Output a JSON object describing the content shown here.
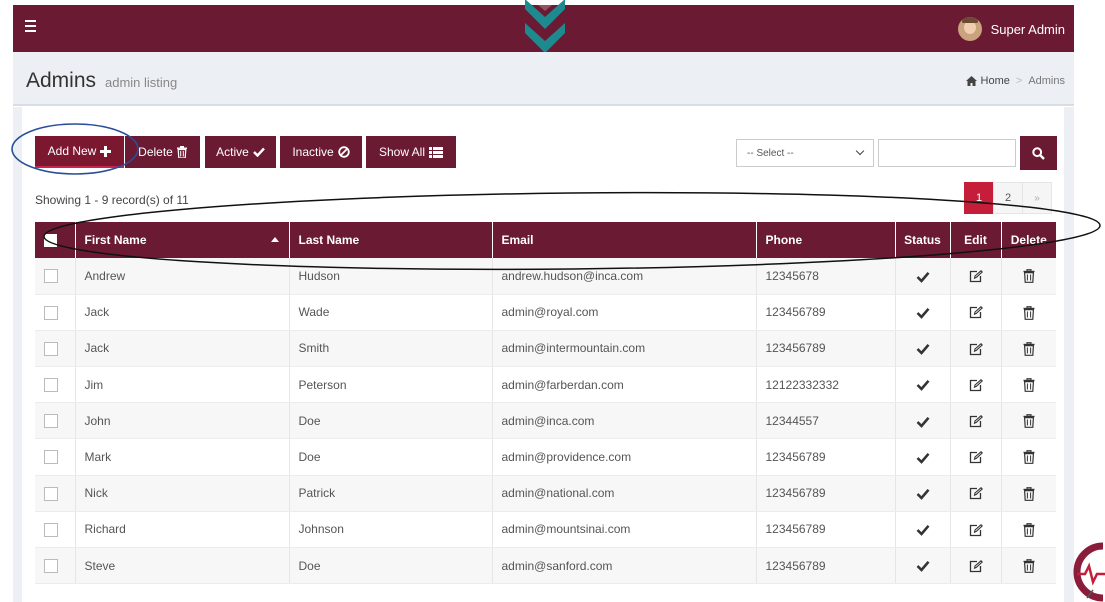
{
  "header": {
    "user_name": "Super Admin"
  },
  "page": {
    "title": "Admins",
    "subtitle": "admin listing"
  },
  "breadcrumb": {
    "home": "Home",
    "current": "Admins"
  },
  "toolbar": {
    "add_label": "Add New",
    "delete_label": "Delete",
    "active_label": "Active",
    "inactive_label": "Inactive",
    "show_all_label": "Show All"
  },
  "filter": {
    "select_value": "-- Select --",
    "search_value": ""
  },
  "listing": {
    "showing_text": "Showing 1 - 9 record(s) of 11"
  },
  "pagination": {
    "pages": [
      "1",
      "2"
    ],
    "current": "1",
    "next": "»"
  },
  "table": {
    "headers": {
      "first_name": "First Name",
      "last_name": "Last Name",
      "email": "Email",
      "phone": "Phone",
      "status": "Status",
      "edit": "Edit",
      "delete": "Delete"
    },
    "rows": [
      {
        "first": "Andrew",
        "last": "Hudson",
        "email": "andrew.hudson@inca.com",
        "phone": "12345678"
      },
      {
        "first": "Jack",
        "last": "Wade",
        "email": "admin@royal.com",
        "phone": "123456789"
      },
      {
        "first": "Jack",
        "last": "Smith",
        "email": "admin@intermountain.com",
        "phone": "123456789"
      },
      {
        "first": "Jim",
        "last": "Peterson",
        "email": "admin@farberdan.com",
        "phone": "12122332332"
      },
      {
        "first": "John",
        "last": "Doe",
        "email": "admin@inca.com",
        "phone": "12344557"
      },
      {
        "first": "Mark",
        "last": "Doe",
        "email": "admin@providence.com",
        "phone": "123456789"
      },
      {
        "first": "Nick",
        "last": "Patrick",
        "email": "admin@national.com",
        "phone": "123456789"
      },
      {
        "first": "Richard",
        "last": "Johnson",
        "email": "admin@mountsinai.com",
        "phone": "123456789"
      },
      {
        "first": "Steve",
        "last": "Doe",
        "email": "admin@sanford.com",
        "phone": "123456789"
      }
    ]
  },
  "icons": {
    "menu": "hamburger-icon",
    "add": "plus-icon",
    "delete": "trash-icon",
    "active": "check-icon",
    "inactive": "ban-icon",
    "show_all": "list-icon",
    "search": "search-icon",
    "home": "home-icon",
    "status": "check-icon",
    "edit": "edit-icon",
    "row_delete": "trash-icon"
  },
  "colors": {
    "brand": "#6b1a33",
    "accent_teal": "#1c8a8f",
    "pager_active": "#c41e3a",
    "annotation_blue": "#2a4f9a"
  }
}
